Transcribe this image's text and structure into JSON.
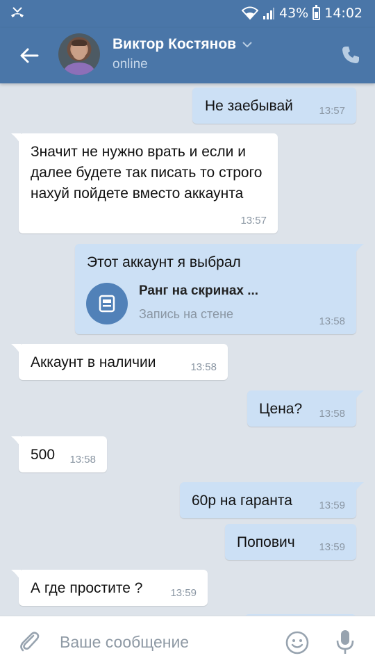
{
  "status_bar": {
    "battery": "43%",
    "time": "14:02",
    "icons": [
      "missed-call-icon",
      "wifi-icon",
      "signal-icon",
      "battery-icon"
    ]
  },
  "header": {
    "contact_name": "Виктор Костянов",
    "status": "online",
    "icons": [
      "back-arrow-icon",
      "chevron-down-icon",
      "phone-icon"
    ]
  },
  "messages": [
    {
      "direction": "out",
      "text": "Не заебывай",
      "time": "13:57"
    },
    {
      "direction": "in",
      "text": "Значит не нужно врать и если и далее будете так писать то строго нахуй пойдете вместо аккаунта",
      "time": "13:57"
    },
    {
      "direction": "out",
      "text": "Этот аккаунт я выбрал",
      "time": "13:58",
      "attachment": {
        "title": "Ранг на скринах ...",
        "subtitle": "Запись на стене",
        "icon": "wall-post-icon"
      }
    },
    {
      "direction": "in",
      "text": "Аккаунт в наличии",
      "time": "13:58"
    },
    {
      "direction": "out",
      "text": "Цена?",
      "time": "13:58"
    },
    {
      "direction": "in",
      "text": "500",
      "time": "13:58"
    },
    {
      "direction": "out",
      "text": "60р на гаранта",
      "time": "13:59"
    },
    {
      "direction": "out",
      "text": "Попович",
      "time": "13:59"
    },
    {
      "direction": "in",
      "text": "А где простите ?",
      "time": "13:59"
    }
  ],
  "input_bar": {
    "placeholder": "Ваше сообщение",
    "icons": [
      "paperclip-icon",
      "emoji-icon",
      "microphone-icon"
    ]
  },
  "colors": {
    "header": "#4a76a8",
    "background": "#dde3ea",
    "incoming_bubble": "#ffffff",
    "outgoing_bubble": "#cce0f5",
    "accent": "#5181b8"
  }
}
